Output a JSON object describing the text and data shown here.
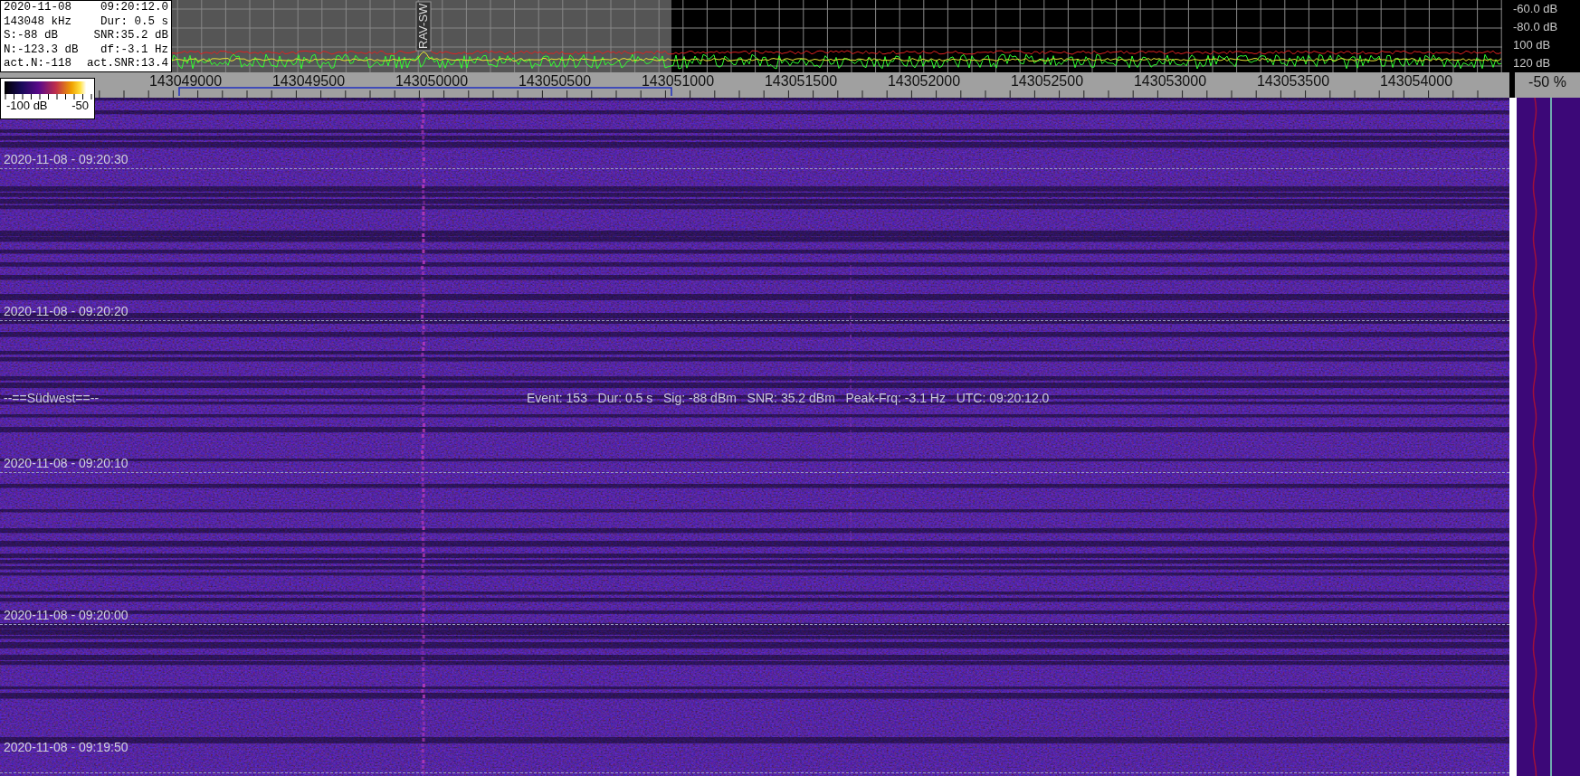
{
  "readout": [
    {
      "left": "2020-11-08",
      "right": "09:20:12.0"
    },
    {
      "left": "143048 kHz",
      "right": "Dur: 0.5 s"
    },
    {
      "left": "S:-88 dB",
      "right": "SNR:35.2 dB"
    },
    {
      "left": "N:-123.3 dB",
      "right": "df:-3.1 Hz"
    },
    {
      "left": "act.N:-118",
      "right": "act.SNR:13.4"
    }
  ],
  "color_scale": {
    "min_label": "-100 dB",
    "max_label": "-50"
  },
  "spectrum": {
    "marker_label": "RAV-SW",
    "db_labels": [
      "-60.0 dB",
      "-80.0 dB",
      "100 dB",
      "120 dB"
    ]
  },
  "frequency_axis": {
    "labels": [
      "143049000",
      "143049500",
      "143050000",
      "143050500",
      "143051000",
      "143051500",
      "143052000",
      "143052500",
      "143053000",
      "143053500",
      "143054000"
    ]
  },
  "level_panel": {
    "label": "-50 %"
  },
  "waterfall": {
    "time_marks": [
      "2020-11-08 - 09:20:30",
      "2020-11-08 - 09:20:20",
      "2020-11-08 - 09:20:10",
      "2020-11-08 - 09:20:00",
      "2020-11-08 - 09:19:50"
    ],
    "station_label": "--==Südwest==--",
    "event_info": "Event: 153   Dur: 0.5 s   Sig: -88 dBm   SNR: 35.2 dBm   Peak-Frq: -3.1 Hz   UTC: 09:20:12.0"
  }
}
